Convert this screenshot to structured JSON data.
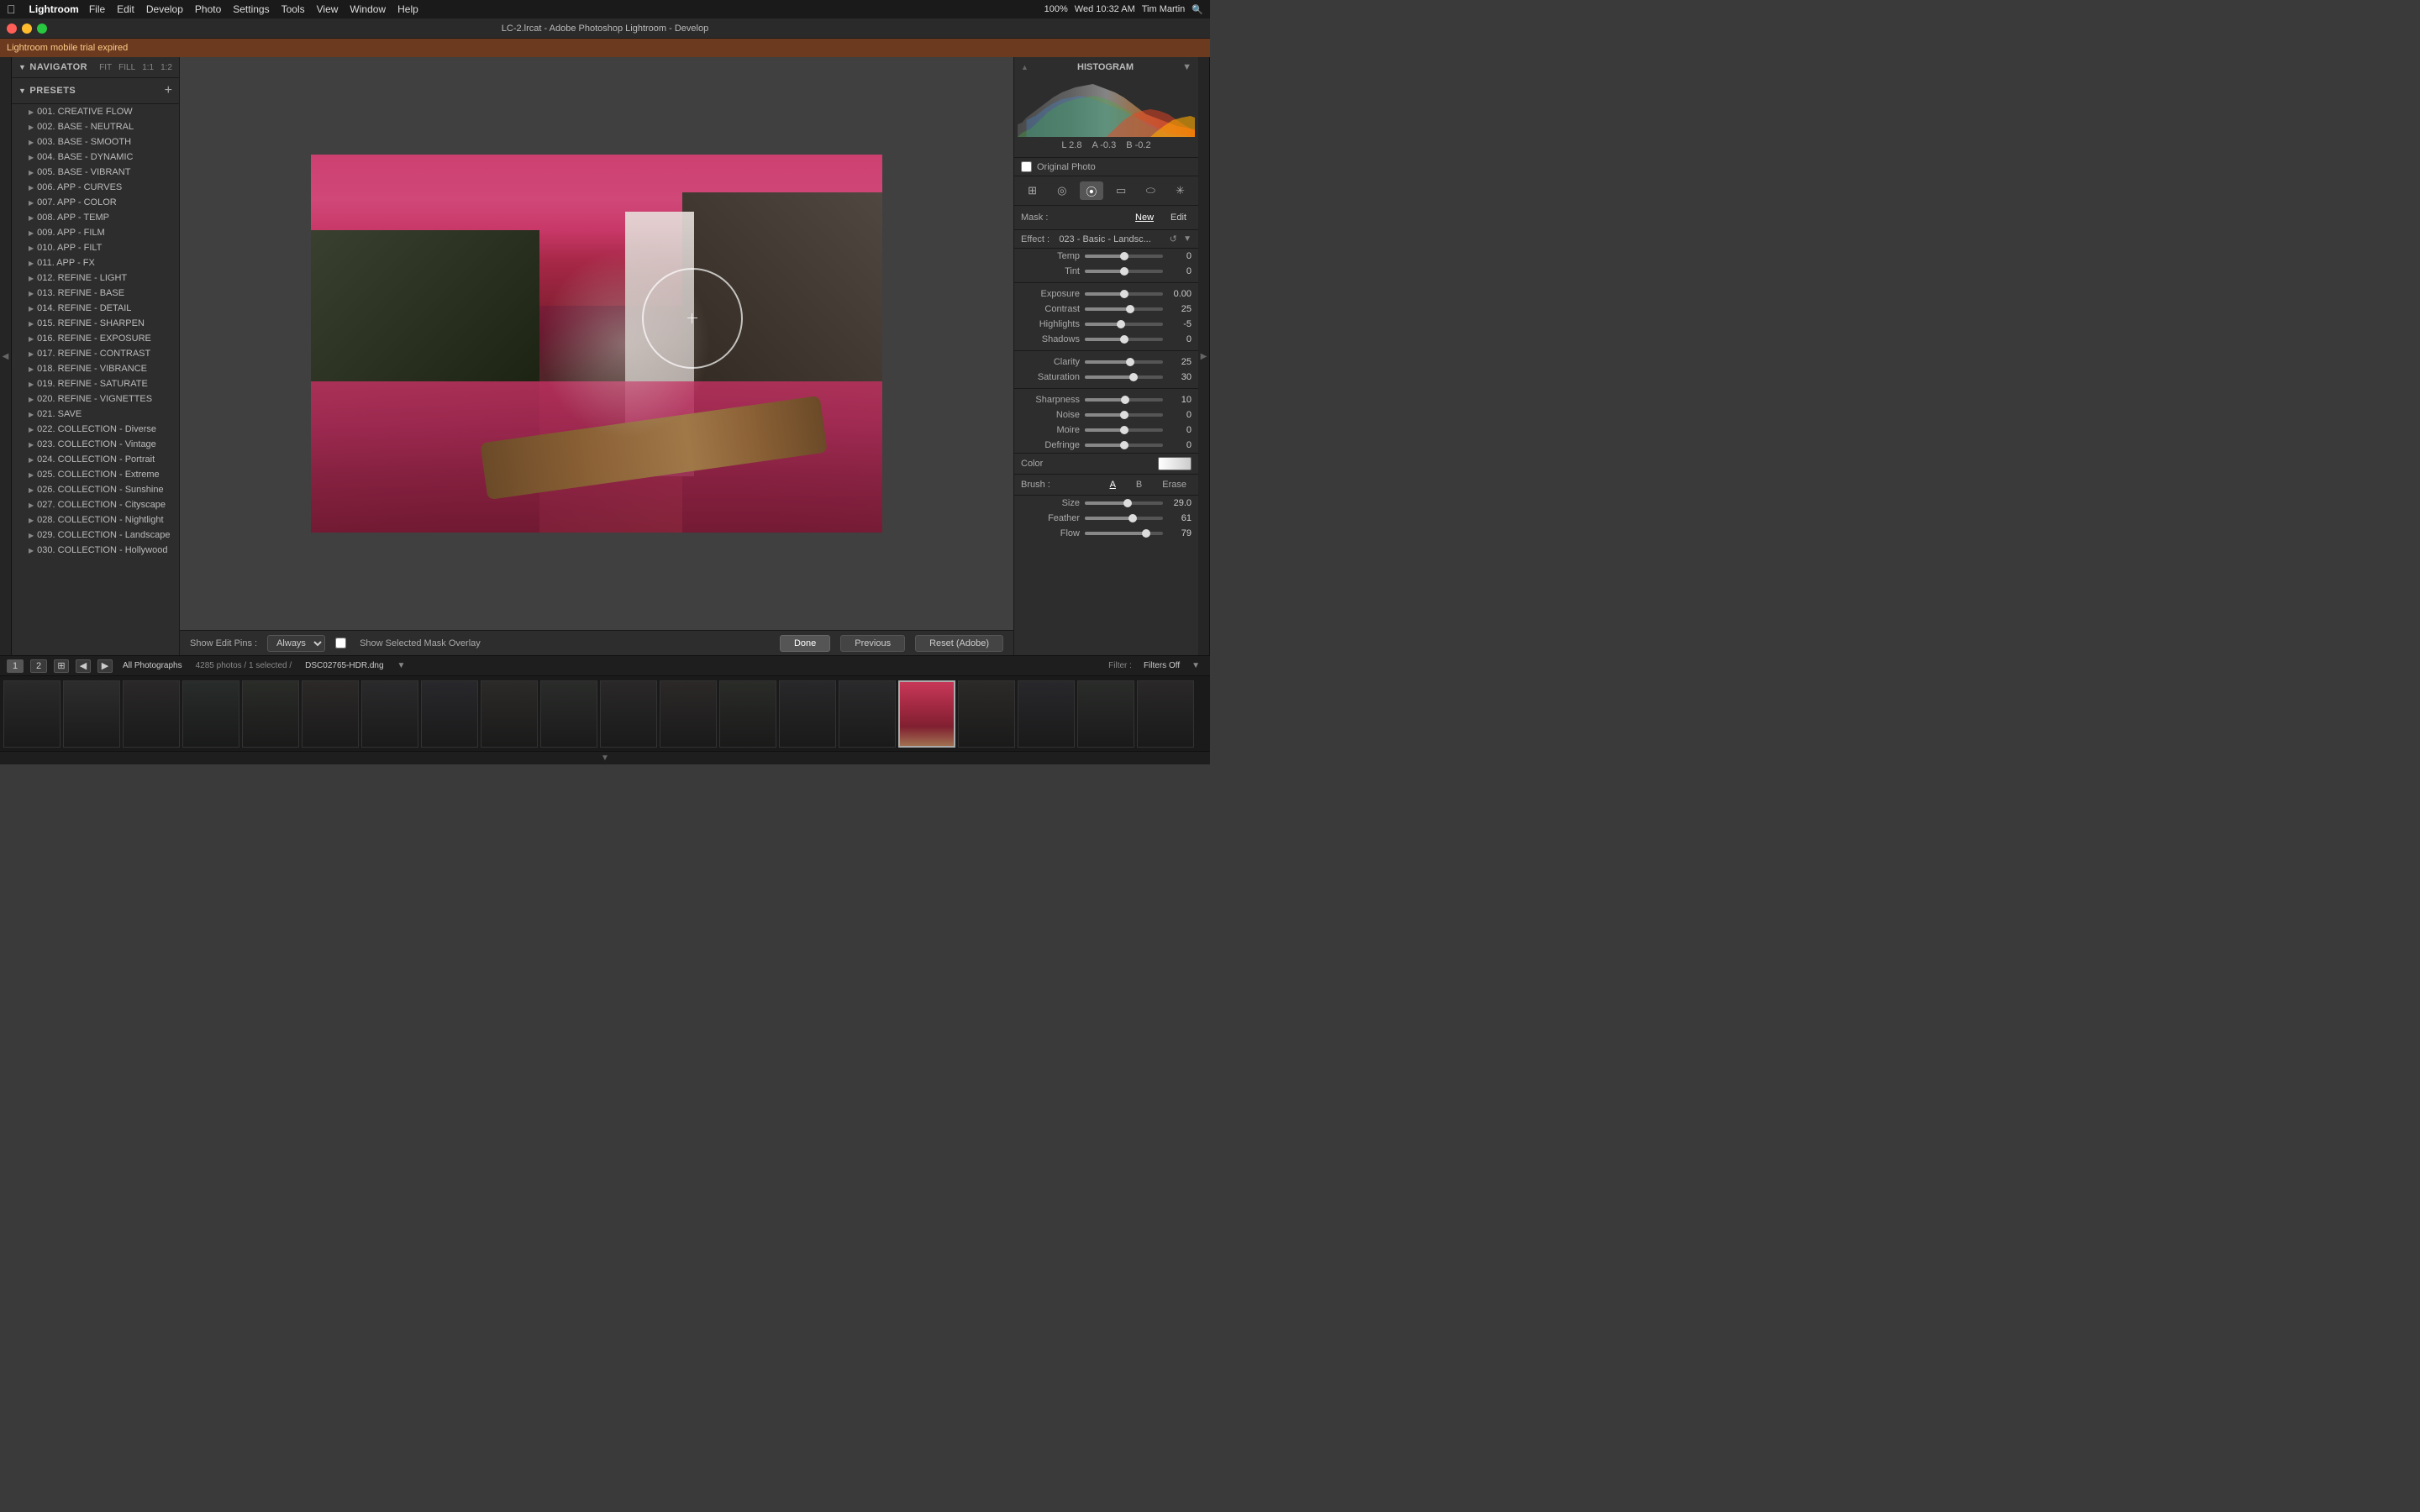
{
  "menubar": {
    "apple": "⌘",
    "app_name": "Lightroom",
    "menus": [
      "File",
      "Edit",
      "Develop",
      "Photo",
      "Settings",
      "Tools",
      "View",
      "Window",
      "Help"
    ],
    "right_time": "Wed 10:32 AM",
    "right_user": "Tim Martin",
    "battery": "100%"
  },
  "titlebar": {
    "title": "LC-2.lrcat - Adobe Photoshop Lightroom - Develop"
  },
  "alert": {
    "message": "Lightroom mobile trial expired"
  },
  "navigator": {
    "title": "Navigator",
    "controls": [
      "FIT",
      "FILL",
      "1:1",
      "1:2"
    ]
  },
  "presets": {
    "title": "Presets",
    "add_icon": "+",
    "items": [
      {
        "id": "001",
        "label": "001. CREATIVE FLOW"
      },
      {
        "id": "002",
        "label": "002. BASE - NEUTRAL"
      },
      {
        "id": "003",
        "label": "003. BASE - SMOOTH"
      },
      {
        "id": "004",
        "label": "004. BASE - DYNAMIC"
      },
      {
        "id": "005",
        "label": "005. BASE - VIBRANT"
      },
      {
        "id": "006",
        "label": "006. APP - CURVES"
      },
      {
        "id": "007",
        "label": "007. APP - COLOR"
      },
      {
        "id": "008",
        "label": "008. APP - TEMP"
      },
      {
        "id": "009",
        "label": "009. APP - FILM"
      },
      {
        "id": "010",
        "label": "010. APP - FILT"
      },
      {
        "id": "011",
        "label": "011. APP - FX"
      },
      {
        "id": "012",
        "label": "012. REFINE - LIGHT"
      },
      {
        "id": "013",
        "label": "013. REFINE - BASE"
      },
      {
        "id": "014",
        "label": "014. REFINE - DETAIL"
      },
      {
        "id": "015",
        "label": "015. REFINE - SHARPEN"
      },
      {
        "id": "016",
        "label": "016. REFINE - EXPOSURE"
      },
      {
        "id": "017",
        "label": "017. REFINE - CONTRAST"
      },
      {
        "id": "018",
        "label": "018. REFINE - VIBRANCE"
      },
      {
        "id": "019",
        "label": "019. REFINE - SATURATE"
      },
      {
        "id": "020",
        "label": "020. REFINE - VIGNETTES"
      },
      {
        "id": "021",
        "label": "021. SAVE"
      },
      {
        "id": "022",
        "label": "022. COLLECTION - Diverse"
      },
      {
        "id": "023",
        "label": "023. COLLECTION - Vintage"
      },
      {
        "id": "024",
        "label": "024. COLLECTION - Portrait"
      },
      {
        "id": "025",
        "label": "025. COLLECTION - Extreme"
      },
      {
        "id": "026",
        "label": "026. COLLECTION - Sunshine"
      },
      {
        "id": "027",
        "label": "027. COLLECTION - Cityscape"
      },
      {
        "id": "028",
        "label": "028. COLLECTION - Nightlight"
      },
      {
        "id": "029",
        "label": "029. COLLECTION - Landscape"
      },
      {
        "id": "030",
        "label": "030. COLLECTION - Hollywood"
      }
    ]
  },
  "toolbar": {
    "show_edit_pins_label": "Show Edit Pins :",
    "always_option": "Always",
    "show_mask_label": "Show Selected Mask Overlay",
    "done_btn": "Done",
    "previous_btn": "Previous",
    "reset_btn": "Reset (Adobe)"
  },
  "histogram": {
    "title": "Histogram",
    "l_val": "2.8",
    "a_val": "-0.3",
    "b_val": "-0.2",
    "l_label": "L",
    "a_label": "A",
    "b_label": "B"
  },
  "mask": {
    "label": "Mask :",
    "new_btn": "New",
    "edit_btn": "Edit"
  },
  "effect": {
    "label": "Effect :",
    "value": "023 - Basic - Landsc...",
    "reset": "↺"
  },
  "sliders": {
    "temp": {
      "label": "Temp",
      "value": 0,
      "pct": 50
    },
    "tint": {
      "label": "Tint",
      "value": 0,
      "pct": 50
    },
    "exposure": {
      "label": "Exposure",
      "value": "0.00",
      "pct": 50
    },
    "contrast": {
      "label": "Contrast",
      "value": 25,
      "pct": 58
    },
    "highlights": {
      "label": "Highlights",
      "value": -5,
      "pct": 46
    },
    "shadows": {
      "label": "Shadows",
      "value": 0,
      "pct": 50
    },
    "clarity": {
      "label": "Clarity",
      "value": 25,
      "pct": 58
    },
    "saturation": {
      "label": "Saturation",
      "value": 30,
      "pct": 62
    },
    "sharpness": {
      "label": "Sharpness",
      "value": 10,
      "pct": 52
    },
    "noise": {
      "label": "Noise",
      "value": 0,
      "pct": 50
    },
    "moire": {
      "label": "Moire",
      "value": 0,
      "pct": 50
    },
    "defringe": {
      "label": "Defringe",
      "value": 0,
      "pct": 50
    }
  },
  "color": {
    "label": "Color"
  },
  "brush": {
    "label": "Brush :",
    "a_btn": "A",
    "b_btn": "B",
    "erase_btn": "Erase",
    "size_label": "Size",
    "size_val": "29.0",
    "size_pct": 55,
    "feather_label": "Feather",
    "feather_val": "61",
    "feather_pct": 61,
    "flow_label": "Flow",
    "flow_val": "79",
    "flow_pct": 79
  },
  "original_photo": {
    "label": "Original Photo"
  },
  "statusbar": {
    "num1": "1",
    "num2": "2",
    "all_photos": "All Photographs",
    "count": "4285 photos / 1 selected /",
    "filename": "DSC02765-HDR.dng",
    "filter_label": "Filter :",
    "filter_value": "Filters Off"
  }
}
